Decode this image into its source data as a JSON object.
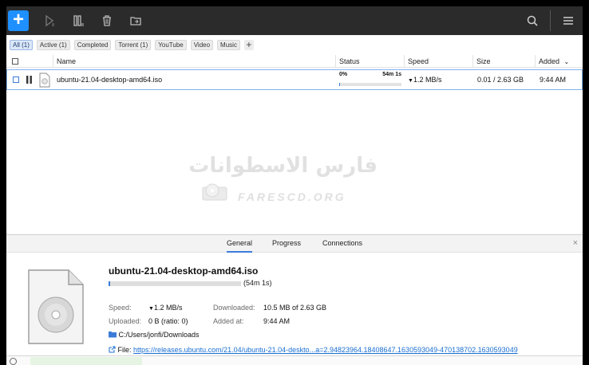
{
  "toolbar": {
    "add_label": "+",
    "icons": [
      "plus-icon",
      "play-icon",
      "pause-icon",
      "trash-icon",
      "folder-icon",
      "search-icon",
      "menu-icon"
    ]
  },
  "filters": {
    "items": [
      "All (1)",
      "Active (1)",
      "Completed",
      "Torrent (1)",
      "YouTube",
      "Video",
      "Music"
    ],
    "add": "+"
  },
  "table": {
    "headers": {
      "name": "Name",
      "status": "Status",
      "speed": "Speed",
      "size": "Size",
      "added": "Added"
    },
    "rows": [
      {
        "name": "ubuntu-21.04-desktop-amd64.iso",
        "progress_text": "0%",
        "eta": "54m 1s",
        "progress": 0.004,
        "speed": "1.2 MB/s",
        "size": "0.01 / 2.63 GB",
        "added": "9:44 AM"
      }
    ]
  },
  "watermark": {
    "arabic": "فارس الاسطوانات",
    "latin": "FARESCD.ORG"
  },
  "details": {
    "tabs": [
      "General",
      "Progress",
      "Connections"
    ],
    "close": "×",
    "title": "ubuntu-21.04-desktop-amd64.iso",
    "eta": "(54m 1s)",
    "progress": 0.004,
    "speed_label": "Speed:",
    "speed_value": "1.2 MB/s",
    "downloaded_label": "Downloaded:",
    "downloaded_value": "10.5 MB of 2.63 GB",
    "uploaded_label": "Uploaded:",
    "uploaded_value": "0 B (ratio: 0)",
    "added_label": "Added at:",
    "added_value": "9:44 AM",
    "folder": "C:/Users/jonfi/Downloads",
    "file_label": "File:",
    "file_url": "https://releases.ubuntu.com/21.04/ubuntu-21.04-deskto...a=2.94823964.18408647.1630593049-470138702.1630593049"
  },
  "colors": {
    "accent": "#1e90ff",
    "toolbar": "#2b2b2b",
    "selection": "#7fb2ee"
  }
}
